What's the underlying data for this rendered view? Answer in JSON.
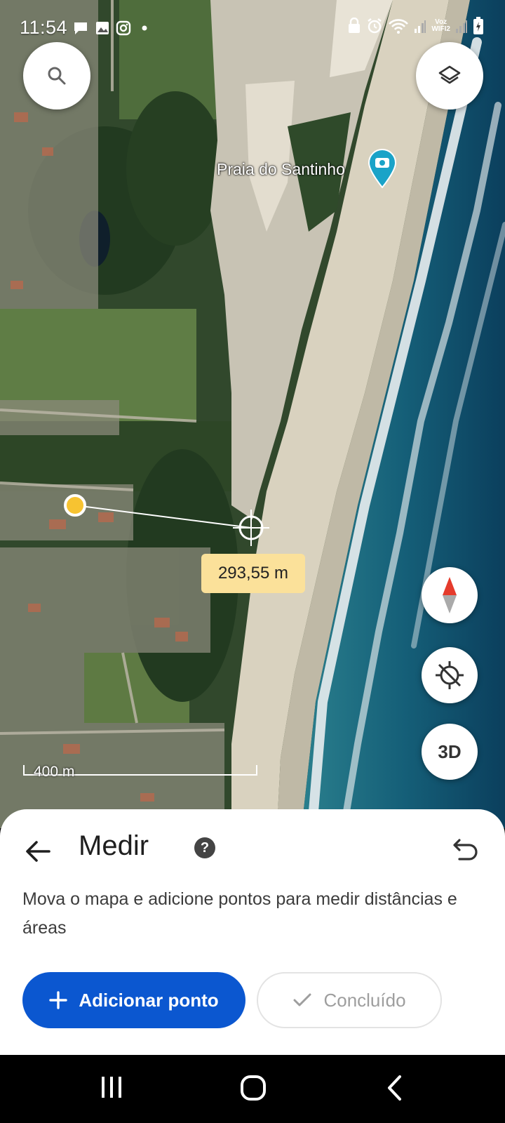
{
  "status_bar": {
    "time": "11:54",
    "left_icons": [
      "message-icon",
      "gallery-icon",
      "instagram-icon",
      "dot-icon"
    ],
    "right_icons": [
      "lock-icon",
      "alarm-icon",
      "wifi-icon",
      "signal-icon",
      "voz-wifi-label",
      "signal-icon-2",
      "battery-icon"
    ],
    "voz_line1": "Voz",
    "voz_line2": "WIFI2"
  },
  "map": {
    "place_name": "Praia do Santinho",
    "place_icon": "camera-pin-icon",
    "measurement": "293,55 m",
    "scale_label": "400 m",
    "controls": [
      "search-icon",
      "layers-icon",
      "compass-icon",
      "location-disabled-icon"
    ],
    "button_3d": "3D",
    "colors": {
      "place_pin": "#1aa3c8",
      "measurement_bg": "#fbe19a",
      "start_point": "#f7c331"
    }
  },
  "sheet": {
    "title": "Medir",
    "help": "?",
    "description": "Mova o mapa e adicione pontos para medir distâncias e áreas",
    "add_button": "Adicionar ponto",
    "done_button": "Concluído",
    "colors": {
      "primary": "#0b57d0"
    }
  },
  "nav_bar": {
    "buttons": [
      "recents-icon",
      "home-icon",
      "back-icon"
    ]
  }
}
